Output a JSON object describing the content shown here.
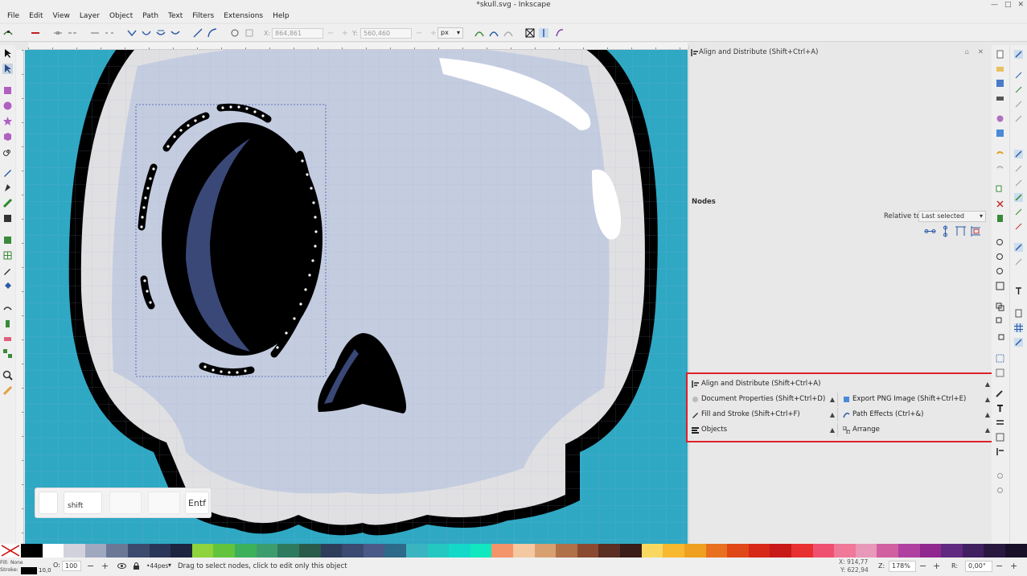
{
  "window": {
    "title": "*skull.svg - Inkscape"
  },
  "menu": [
    "File",
    "Edit",
    "View",
    "Layer",
    "Object",
    "Path",
    "Text",
    "Filters",
    "Extensions",
    "Help"
  ],
  "toolbar": {
    "x_label": "X:",
    "x_value": "864,861",
    "y_label": "Y:",
    "y_value": "560,460",
    "unit": "px"
  },
  "keys": [
    {
      "label": ""
    },
    {
      "label": "shift"
    },
    {
      "label": ""
    },
    {
      "label": ""
    },
    {
      "label": "Entf"
    }
  ],
  "dock": {
    "title": "Align and Distribute (Shift+Ctrl+A)",
    "nodes_heading": "Nodes",
    "relative_to_label": "Relative to:",
    "relative_to_value": "Last selected"
  },
  "panels": {
    "align": "Align and Distribute (Shift+Ctrl+A)",
    "doc_props": "Document Properties (Shift+Ctrl+D)",
    "export_png": "Export PNG Image (Shift+Ctrl+E)",
    "fill_stroke": "Fill and Stroke (Shift+Ctrl+F)",
    "path_effects": "Path Effects (Ctrl+&)",
    "objects": "Objects",
    "arrange": "Arrange"
  },
  "palette": [
    "#000000",
    "#ffffff",
    "#d2d2dc",
    "#a0a8c0",
    "#6a7896",
    "#3c4a6e",
    "#2a3658",
    "#1c2440",
    "#8ed23c",
    "#62c43c",
    "#3cb05a",
    "#3c9c6e",
    "#2e7a5e",
    "#2a5a4a",
    "#2c3e5a",
    "#3a4a70",
    "#4a5a88",
    "#2e6a8a",
    "#3ab4c0",
    "#24c8c0",
    "#14d8c8",
    "#10e8c0",
    "#f4946a",
    "#f4c8a0",
    "#d8a070",
    "#b07048",
    "#8a4a32",
    "#5a2e22",
    "#3a1c18",
    "#f8d860",
    "#f8b830",
    "#f0a020",
    "#e87020",
    "#e04818",
    "#d82818",
    "#c81818",
    "#e83030",
    "#f05070",
    "#f07898",
    "#e898b8",
    "#d060a0",
    "#b040a0",
    "#902890",
    "#602880",
    "#402060",
    "#281840",
    "#181028"
  ],
  "status": {
    "fill_label": "Fill:",
    "fill_value": "None",
    "stroke_label": "Stroke:",
    "stroke_width": "10,0",
    "opacity_label": "O:",
    "opacity_value": "100",
    "layer": "•44pes",
    "message": "Drag to select nodes, click to edit only this object",
    "x_label": "X:",
    "x_value": "914,77",
    "y_label": "Y:",
    "y_value": "622,94",
    "zoom_label": "Z:",
    "zoom_value": "178%",
    "rotation_label": "R:",
    "rotation_value": "0,00°"
  }
}
